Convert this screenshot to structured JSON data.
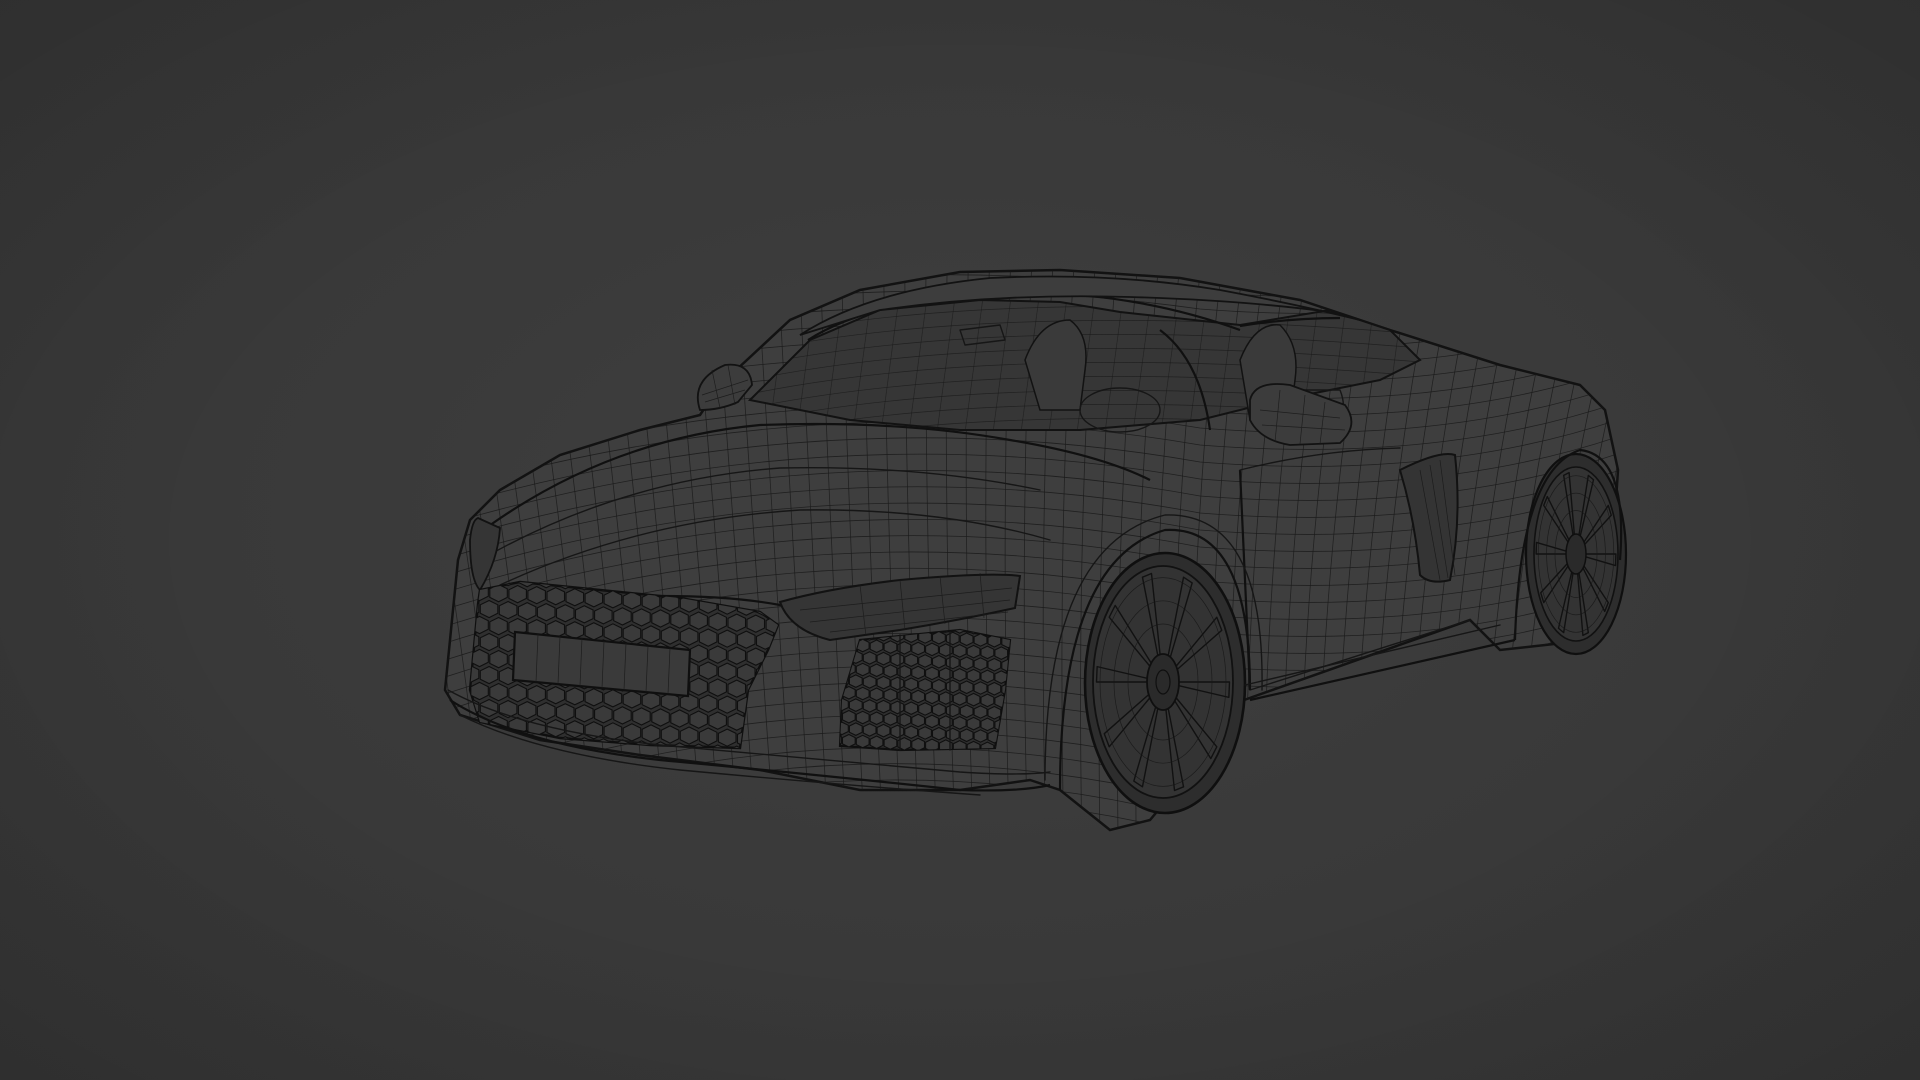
{
  "viewport": {
    "background_color": "#3a3a3a",
    "wire_color": "#161616",
    "shading_mode": "wireframe",
    "subject": "car-wireframe-model"
  }
}
